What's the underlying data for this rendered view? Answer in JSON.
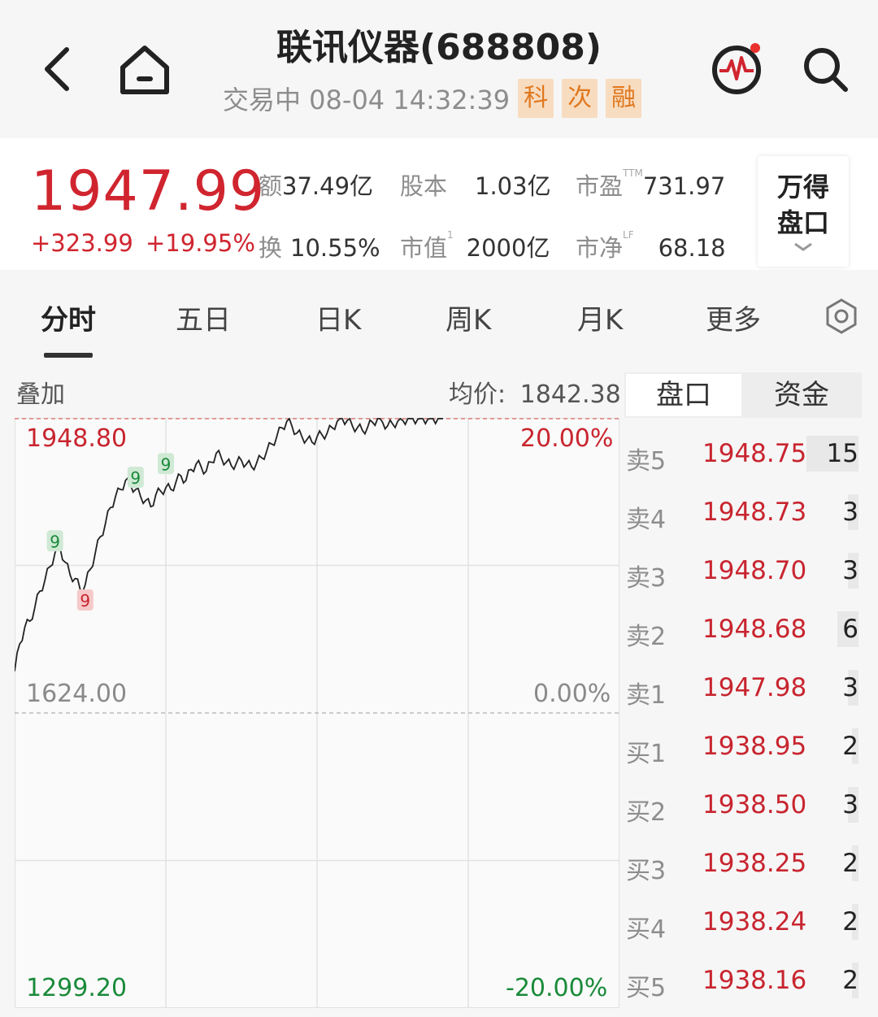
{
  "header": {
    "title": "联讯仪器(688808)",
    "status": "交易中 08-04 14:32:39",
    "tags": [
      "科",
      "次",
      "融"
    ]
  },
  "quote": {
    "price": "1947.99",
    "change": "+323.99",
    "change_pct": "+19.95%",
    "stats": {
      "amount_label": "额",
      "amount_value": "37.49亿",
      "share_capital_label": "股本",
      "share_capital_value": "1.03亿",
      "pe_label": "市盈",
      "pe_sup": "TTM",
      "pe_value": "731.97",
      "turnover_label": "换",
      "turnover_value": "10.55%",
      "mktcap_label": "市值",
      "mktcap_sup": "1",
      "mktcap_value": "2000亿",
      "pb_label": "市净",
      "pb_sup": "LF",
      "pb_value": "68.18"
    },
    "wind_button": [
      "万得",
      "盘口"
    ]
  },
  "tabs": [
    "分时",
    "五日",
    "日K",
    "周K",
    "月K",
    "更多"
  ],
  "chart_header": {
    "overlay_label": "叠加",
    "avg_label": "均价:",
    "avg_value": "1842.38"
  },
  "chart_data": {
    "type": "line",
    "y_labels_left": [
      "1948.80",
      "1624.00",
      "1299.20"
    ],
    "y_labels_right": [
      "20.00%",
      "0.00%",
      "-20.00%"
    ],
    "ylim": [
      1299.2,
      1948.8
    ],
    "prev_close": 1624.0,
    "x": [
      0,
      2,
      4,
      6,
      8,
      10,
      12,
      14,
      16,
      18,
      20,
      22,
      24,
      26,
      28,
      30,
      32,
      34,
      36,
      38,
      40,
      42,
      44,
      46,
      48,
      50,
      52,
      54,
      56,
      58,
      60,
      62,
      64,
      66,
      68,
      70,
      72,
      74,
      76,
      78,
      80,
      82,
      84,
      86,
      88,
      90,
      92,
      94,
      96,
      98,
      100,
      102,
      104,
      106,
      108,
      110,
      112,
      114,
      116,
      118,
      120,
      122,
      124,
      126,
      128,
      130,
      132,
      134,
      136,
      138,
      140,
      142,
      144,
      146,
      148,
      150,
      152,
      154,
      156,
      158,
      160,
      162,
      164,
      166,
      168,
      170
    ],
    "values": [
      1670,
      1700,
      1718,
      1725,
      1740,
      1758,
      1770,
      1785,
      1800,
      1806,
      1790,
      1776,
      1772,
      1760,
      1765,
      1782,
      1800,
      1818,
      1832,
      1850,
      1862,
      1870,
      1880,
      1875,
      1870,
      1862,
      1858,
      1851,
      1864,
      1868,
      1872,
      1870,
      1878,
      1885,
      1880,
      1892,
      1898,
      1895,
      1890,
      1900,
      1910,
      1905,
      1900,
      1896,
      1899,
      1902,
      1898,
      1895,
      1899,
      1905,
      1912,
      1920,
      1928,
      1938,
      1945,
      1940,
      1932,
      1928,
      1925,
      1922,
      1928,
      1930,
      1932,
      1938,
      1945,
      1948,
      1946,
      1940,
      1938,
      1935,
      1938,
      1944,
      1948.8,
      1944,
      1940,
      1942,
      1945,
      1946,
      1948,
      1947.99,
      1947.5,
      1947.99,
      1947.5,
      1947.9,
      1947.99,
      1947.99
    ],
    "markers": [
      {
        "label": "9",
        "kind": "green",
        "value": 1800,
        "x_index": 8
      },
      {
        "label": "9",
        "kind": "red",
        "value": 1760,
        "x_index": 14
      },
      {
        "label": "9",
        "kind": "green",
        "value": 1870,
        "x_index": 24
      },
      {
        "label": "9",
        "kind": "green",
        "value": 1885,
        "x_index": 30
      }
    ]
  },
  "orderbook": {
    "tabs": [
      "盘口",
      "资金"
    ],
    "rows": [
      {
        "label": "卖5",
        "price": "1948.75",
        "vol": "15",
        "bar": 1.0
      },
      {
        "label": "卖4",
        "price": "1948.73",
        "vol": "3",
        "bar": 0.2
      },
      {
        "label": "卖3",
        "price": "1948.70",
        "vol": "3",
        "bar": 0.2
      },
      {
        "label": "卖2",
        "price": "1948.68",
        "vol": "6",
        "bar": 0.4
      },
      {
        "label": "卖1",
        "price": "1947.98",
        "vol": "3",
        "bar": 0.2
      },
      {
        "label": "买1",
        "price": "1938.95",
        "vol": "2",
        "bar": 0.13
      },
      {
        "label": "买2",
        "price": "1938.50",
        "vol": "3",
        "bar": 0.2
      },
      {
        "label": "买3",
        "price": "1938.25",
        "vol": "2",
        "bar": 0.13
      },
      {
        "label": "买4",
        "price": "1938.24",
        "vol": "2",
        "bar": 0.13
      },
      {
        "label": "买5",
        "price": "1938.16",
        "vol": "2",
        "bar": 0.13
      }
    ]
  },
  "colors": {
    "up": "#c8252f",
    "down": "#1a8a3a",
    "tag_text": "#e0781e",
    "tag_bg": "#f7dcc0"
  }
}
